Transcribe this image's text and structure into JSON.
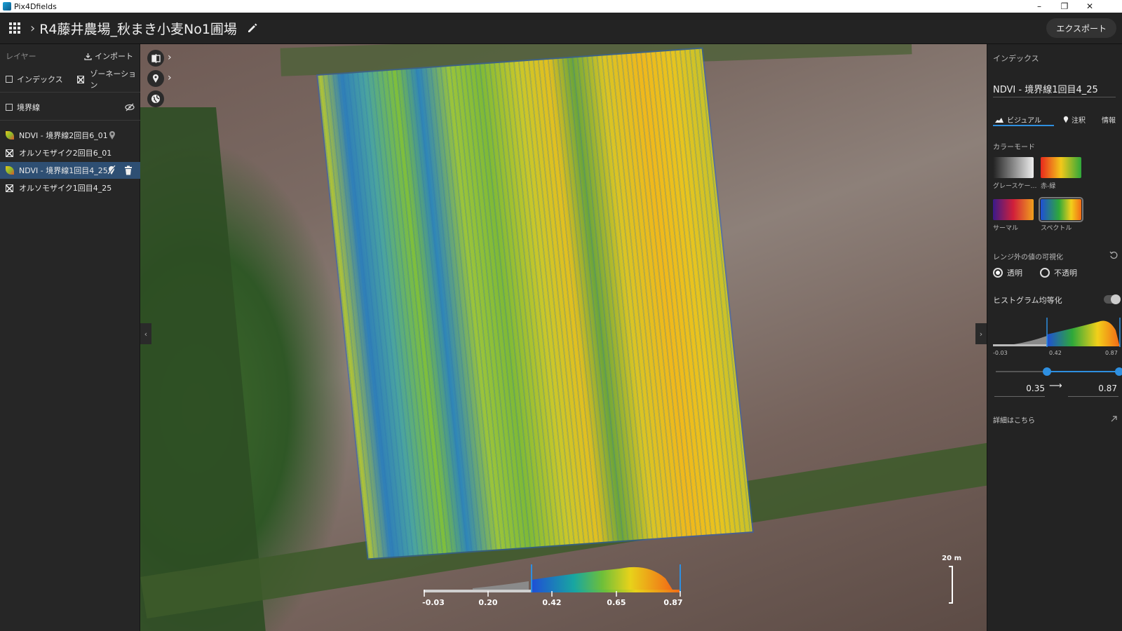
{
  "window": {
    "app_name": "Pix4Dfields",
    "minimize": "–",
    "restore": "❐",
    "close": "✕"
  },
  "header": {
    "project_title": "R4藤井農場_秋まき小麦No1圃場",
    "export_label": "エクスポート"
  },
  "left_panel": {
    "layers_label": "レイヤー",
    "import_label": "インポート",
    "index_label": "インデックス",
    "zonation_label": "ゾーネーション",
    "boundary_label": "境界線",
    "layers": [
      {
        "name": "NDVI - 境界線2回目6_01",
        "type": "ndvi",
        "selected": false
      },
      {
        "name": "オルソモザイク2回目6_01",
        "type": "ortho",
        "selected": false
      },
      {
        "name": "NDVI - 境界線1回目4_25",
        "type": "ndvi",
        "selected": true
      },
      {
        "name": "オルソモザイク1回目4_25",
        "type": "ortho",
        "selected": false
      }
    ]
  },
  "map": {
    "legend_ticks": [
      "-0.03",
      "0.20",
      "0.42",
      "0.65",
      "0.87"
    ],
    "scale_label": "20 m"
  },
  "right_panel": {
    "section_title": "インデックス",
    "index_name": "NDVI - 境界線1回目4_25",
    "tabs": {
      "visual": "ビジュアル",
      "annotation": "注釈",
      "info": "情報"
    },
    "color_mode_label": "カラーモード",
    "color_modes": [
      {
        "label": "グレースケー…",
        "selected": false
      },
      {
        "label": "赤-緑",
        "selected": false
      },
      {
        "label": "サーマル",
        "selected": false
      },
      {
        "label": "スペクトル",
        "selected": true
      }
    ],
    "out_of_range_label": "レンジ外の値の可視化",
    "transparent_label": "透明",
    "opaque_label": "不透明",
    "histogram_eq_label": "ヒストグラム均等化",
    "histogram_ticks": [
      "-0.03",
      "0.42",
      "0.87"
    ],
    "range_min": "0.35",
    "range_max": "0.87",
    "arrow": "⟶",
    "details_label": "詳細はこちら"
  },
  "colors": {
    "accent": "#2e8fe0",
    "selected_row": "#2e4f73"
  }
}
